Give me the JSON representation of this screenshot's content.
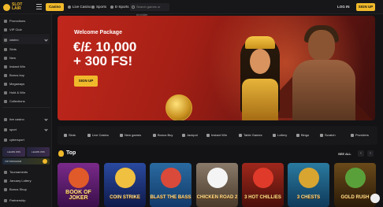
{
  "header": {
    "logo_text": "SLOT\nLAIR",
    "tabs": [
      {
        "label": "Casino",
        "active": true
      },
      {
        "label": "Live Casino",
        "active": false
      },
      {
        "label": "Sports",
        "active": false
      },
      {
        "label": "E-Sports",
        "active": false
      }
    ],
    "search_placeholder": "Search games or provider",
    "login_label": "LOG IN",
    "signup_label": "SIGN UP"
  },
  "sidebar": {
    "items": [
      {
        "label": "Promotions"
      },
      {
        "label": "VIP Club"
      },
      {
        "label": "casino",
        "expandable": true
      },
      {
        "label": "Slots"
      },
      {
        "label": "New"
      },
      {
        "label": "Instant Win"
      },
      {
        "label": "Bonus buy"
      },
      {
        "label": "Megaways"
      },
      {
        "label": "Hold & Win"
      },
      {
        "label": "Collections"
      },
      {
        "label": "live casino",
        "expandable": true
      },
      {
        "label": "sport",
        "expandable": true
      },
      {
        "label": "cybersport"
      }
    ],
    "promo_left": "LEARN WIN",
    "promo_right": "LEARN WIN",
    "promo_wide": "VIP PROGRAM",
    "bottom_items": [
      {
        "label": "Tournaments"
      },
      {
        "label": "January Lottery"
      },
      {
        "label": "Bonus Shop"
      },
      {
        "label": "Partnership"
      }
    ]
  },
  "banner": {
    "welcome": "Welcome Package",
    "line1": "€/£ 10,000",
    "line2": "+ 300 FS!",
    "button": "SIGN UP"
  },
  "categories": [
    {
      "label": "Slots",
      "icon": "slots-icon"
    },
    {
      "label": "Live Casino",
      "icon": "live-casino-icon"
    },
    {
      "label": "New games",
      "icon": "new-games-icon"
    },
    {
      "label": "Bonus Buy",
      "icon": "bonus-buy-icon"
    },
    {
      "label": "Jackpot",
      "icon": "jackpot-icon"
    },
    {
      "label": "Instant Win",
      "icon": "instant-win-icon"
    },
    {
      "label": "Table Games",
      "icon": "table-games-icon"
    },
    {
      "label": "Lottery",
      "icon": "lottery-icon"
    },
    {
      "label": "Bingo",
      "icon": "bingo-icon"
    },
    {
      "label": "Scratch",
      "icon": "scratch-icon"
    }
  ],
  "providers_label": "Providers",
  "top_section": {
    "title": "Top",
    "see_all": "SEE ALL",
    "prev": "‹",
    "next": "›"
  },
  "games": [
    {
      "title": "BOOK OF JOKER",
      "bg": "#5a1a6a"
    },
    {
      "title": "COIN STRIKE",
      "bg": "#1a2f6a"
    },
    {
      "title": "BLAST THE BASS",
      "bg": "#1a4a7a"
    },
    {
      "title": "CHICKEN ROAD 2",
      "bg": "#5a3a2a"
    },
    {
      "title": "3 HOT CHILLIES",
      "bg": "#6a1a14"
    },
    {
      "title": "3 CHESTS",
      "bg": "#1a4a6a"
    },
    {
      "title": "GOLD RUSH",
      "bg": "#3a2a10"
    }
  ],
  "colors": {
    "accent": "#f0b92b",
    "background": "#131315",
    "banner_red": "#c1271c"
  }
}
